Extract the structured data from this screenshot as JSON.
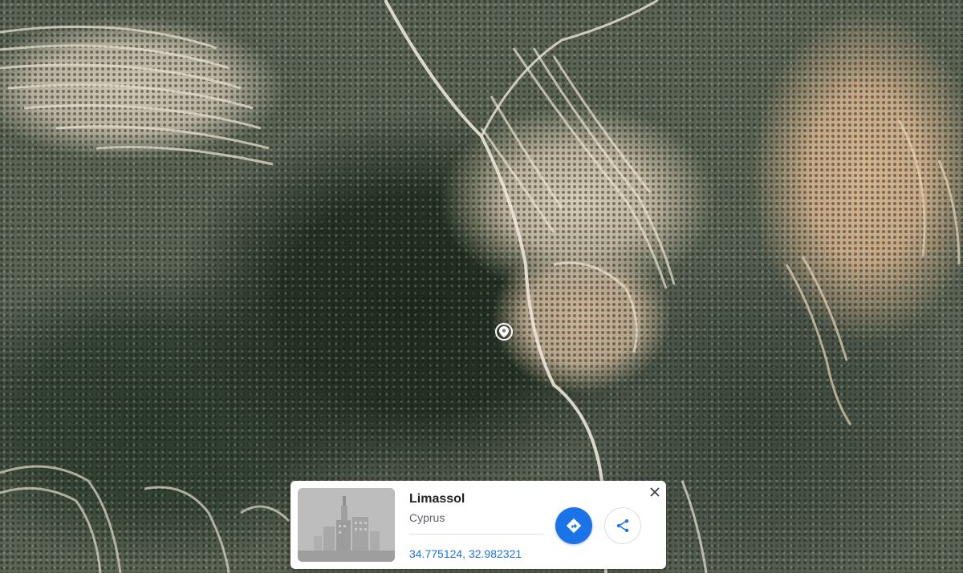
{
  "place_card": {
    "title": "Limassol",
    "subtitle": "Cyprus",
    "coordinates": "34.775124, 32.982321"
  },
  "icons": {
    "pin": "location-pin-icon",
    "directions": "directions-icon",
    "share": "share-icon",
    "close": "close-icon",
    "thumbnail": "city-buildings-thumbnail"
  },
  "colors": {
    "accent": "#1a73e8",
    "card_bg": "#ffffff",
    "title": "#202124",
    "subtitle": "#5f6368"
  }
}
